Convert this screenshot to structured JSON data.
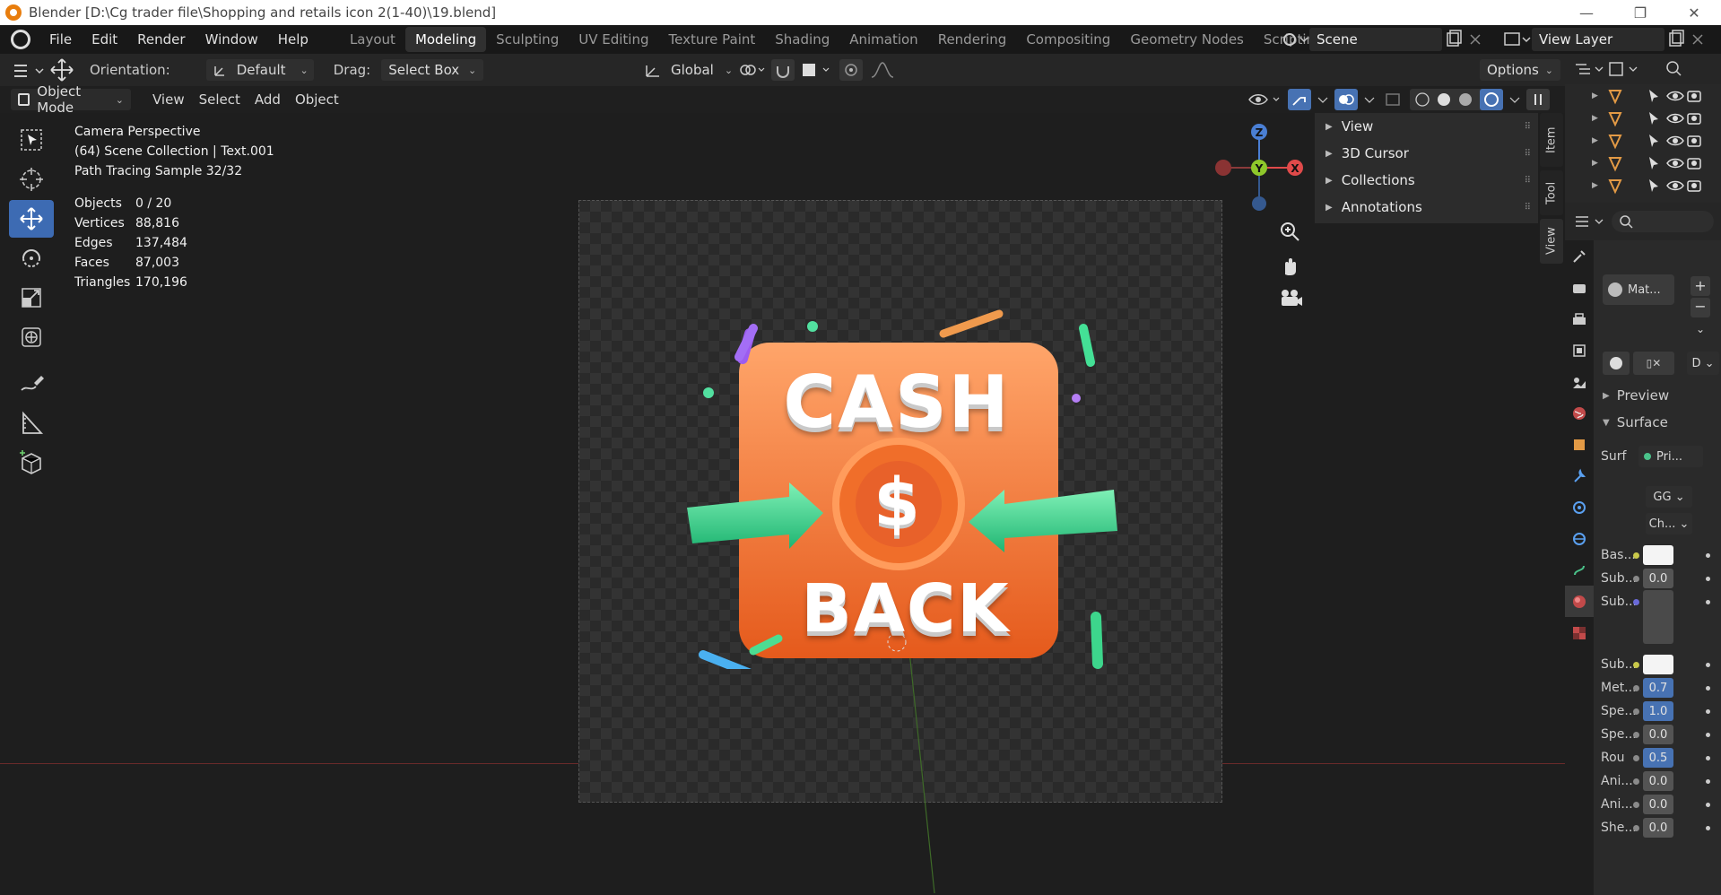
{
  "window": {
    "title": "Blender [D:\\Cg trader file\\Shopping and retails icon 2(1-40)\\19.blend]",
    "controls": [
      "—",
      "❐",
      "✕"
    ]
  },
  "menu": [
    "File",
    "Edit",
    "Render",
    "Window",
    "Help"
  ],
  "workspaces": [
    "Layout",
    "Modeling",
    "Sculpting",
    "UV Editing",
    "Texture Paint",
    "Shading",
    "Animation",
    "Rendering",
    "Compositing",
    "Geometry Nodes",
    "Scripting"
  ],
  "active_workspace": "Modeling",
  "scene": "Scene",
  "view_layer": "View Layer",
  "tool_header": {
    "orientation_label": "Orientation:",
    "orientation_value": "Default",
    "drag_label": "Drag:",
    "drag_value": "Select Box",
    "transform_orientation": "Global",
    "options": "Options"
  },
  "viewport_header": {
    "mode": "Object Mode",
    "menus": [
      "View",
      "Select",
      "Add",
      "Object"
    ]
  },
  "overlay": {
    "line1": "Camera Perspective",
    "line2": "(64) Scene Collection | Text.001",
    "line3": "Path Tracing Sample 32/32"
  },
  "stats": [
    {
      "k": "Objects",
      "v": "0 / 20"
    },
    {
      "k": "Vertices",
      "v": "88,816"
    },
    {
      "k": "Edges",
      "v": "137,484"
    },
    {
      "k": "Faces",
      "v": "87,003"
    },
    {
      "k": "Triangles",
      "v": "170,196"
    }
  ],
  "gizmo": {
    "z": "Z",
    "y": "Y",
    "x": "X"
  },
  "npanel": [
    "View",
    "3D Cursor",
    "Collections",
    "Annotations"
  ],
  "side_tabs": [
    "Item",
    "Tool",
    "View"
  ],
  "artwork": {
    "top": "CASH",
    "symbol": "$",
    "bottom": "BACK"
  },
  "properties": {
    "material_slot": "Mat...",
    "shader_dd": "D",
    "preview": "Preview",
    "surface": "Surface",
    "surf_label": "Surf",
    "surf_value": "Pri...",
    "dd1": "GG",
    "dd2": "Ch...",
    "rows": [
      {
        "k": "Bas...",
        "v": "",
        "type": "white"
      },
      {
        "k": "Sub...",
        "v": "0.0",
        "type": "gray"
      },
      {
        "k": "Sub...",
        "v": "",
        "type": "graybox"
      },
      {
        "k": "Sub...",
        "v": "",
        "type": "white"
      },
      {
        "k": "Met...",
        "v": "0.7",
        "type": "blue"
      },
      {
        "k": "Spe...",
        "v": "1.0",
        "type": "blue"
      },
      {
        "k": "Spe...",
        "v": "0.0",
        "type": "gray"
      },
      {
        "k": "Rou",
        "v": "0.5",
        "type": "blue"
      },
      {
        "k": "Ani...",
        "v": "0.0",
        "type": "gray"
      },
      {
        "k": "Ani...",
        "v": "0.0",
        "type": "gray"
      },
      {
        "k": "She...",
        "v": "0.0",
        "type": "gray"
      }
    ]
  },
  "colors": {
    "accent": "#4772b3",
    "orange": "#f07a2e",
    "green": "#3dd68c"
  }
}
